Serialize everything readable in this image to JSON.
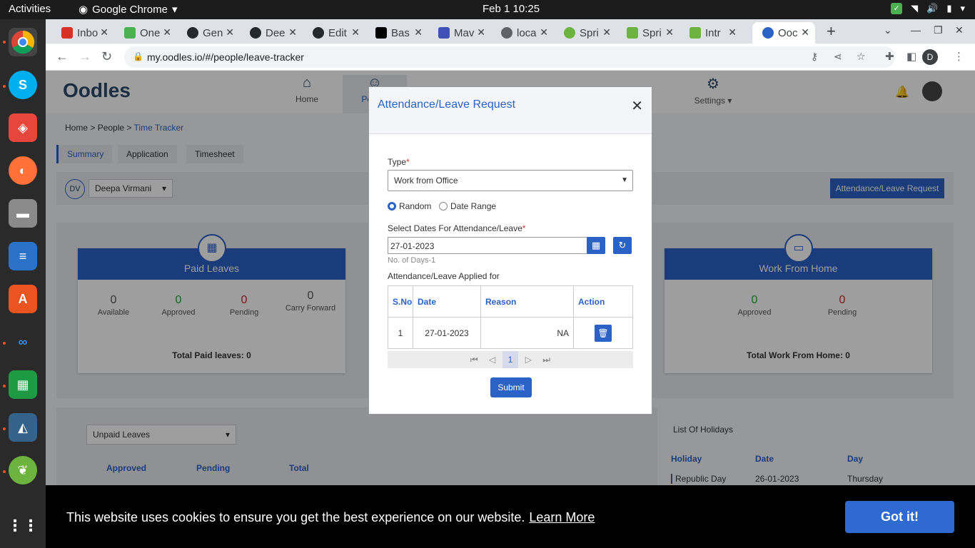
{
  "system": {
    "activities": "Activities",
    "app_name": "Google Chrome",
    "clock": "Feb 1  10:25"
  },
  "chrome": {
    "tabs": [
      {
        "label": "Inbo",
        "color": "#d93025"
      },
      {
        "label": "One",
        "color": "#4caf50"
      },
      {
        "label": "Gen",
        "color": "#24292f"
      },
      {
        "label": "Dee",
        "color": "#24292f"
      },
      {
        "label": "Edit",
        "color": "#24292f"
      },
      {
        "label": "Bas",
        "color": "#000000"
      },
      {
        "label": "Mav",
        "color": "#3f51b5"
      },
      {
        "label": "loca",
        "color": "#5f6368"
      },
      {
        "label": "Spri",
        "color": "#6db33f"
      },
      {
        "label": "Spri",
        "color": "#6db33f"
      },
      {
        "label": "Intr",
        "color": "#6db33f"
      },
      {
        "label": "Ooc",
        "color": "#2b62c5"
      }
    ],
    "url": "my.oodles.io/#/people/leave-tracker",
    "profile_initial": "D"
  },
  "header": {
    "logo": "Oodles",
    "nav": [
      {
        "label": "Home",
        "icon": "home-icon"
      },
      {
        "label": "People",
        "icon": "people-icon"
      },
      {
        "label": "Settings",
        "icon": "settings-icon"
      }
    ]
  },
  "breadcrumb": {
    "home": "Home",
    "people": "People",
    "current": "Time Tracker"
  },
  "subtabs": [
    "Summary",
    "Application",
    "Timesheet"
  ],
  "user": {
    "initials": "DV",
    "name": "Deepa Virmani"
  },
  "request_button": "Attendance/Leave Request",
  "paid_leaves": {
    "title": "Paid Leaves",
    "stats": [
      {
        "value": "0",
        "label": "Available",
        "color": "#555555"
      },
      {
        "value": "0",
        "label": "Approved",
        "color": "#2e9e3c"
      },
      {
        "value": "0",
        "label": "Pending",
        "color": "#c62828"
      },
      {
        "value": "0",
        "label": "Carry Forward",
        "color": "#555555"
      }
    ],
    "total": "Total Paid leaves: 0"
  },
  "wfh": {
    "title": "Work From Home",
    "stats": [
      {
        "value": "0",
        "label": "Approved",
        "color": "#2e9e3c"
      },
      {
        "value": "0",
        "label": "Pending",
        "color": "#c62828"
      }
    ],
    "total": "Total Work From Home: 0"
  },
  "unpaid": {
    "select": "Unpaid Leaves",
    "cols": [
      "Approved",
      "Pending",
      "Total"
    ]
  },
  "holidays": {
    "title": "List Of Holidays",
    "cols": [
      "Holiday",
      "Date",
      "Day"
    ],
    "rows": [
      {
        "holiday": "Republic Day",
        "date": "26-01-2023",
        "day": "Thursday"
      }
    ]
  },
  "modal": {
    "title": "Attendance/Leave Request",
    "type_label": "Type",
    "type_value": "Work from Office",
    "radio_random": "Random",
    "radio_range": "Date Range",
    "dates_label": "Select Dates For Attendance/Leave",
    "date_value": "27-01-2023",
    "days_note": "No. of Days-1",
    "applied_label": "Attendance/Leave Applied for",
    "table_headers": [
      "S.No",
      "Date",
      "Reason",
      "Action"
    ],
    "rows": [
      {
        "sno": "1",
        "date": "27-01-2023",
        "reason": "NA"
      }
    ],
    "page": "1",
    "submit": "Submit"
  },
  "cookie": {
    "message": "This website uses cookies to ensure you get the best experience on our website.",
    "learn_more": "Learn More",
    "accept": "Got it!"
  }
}
